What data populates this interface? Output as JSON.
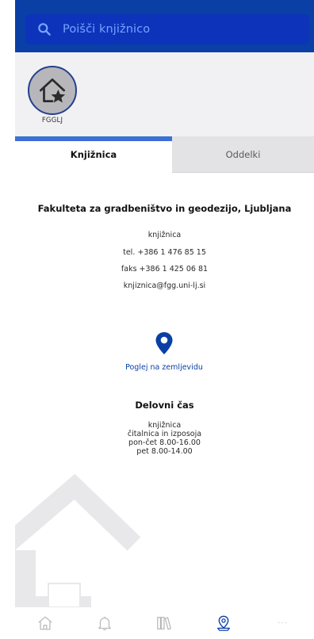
{
  "search": {
    "placeholder": "Poišči knjižnico"
  },
  "library": {
    "code": "FGGLJ"
  },
  "tabs": [
    {
      "label": "Knjižnica",
      "active": true
    },
    {
      "label": "Oddelki",
      "active": false
    }
  ],
  "details": {
    "name": "Fakulteta za gradbeništvo in geodezijo, Ljubljana",
    "department": "knjižnica",
    "phone": "tel. +386 1 476 85 15",
    "fax": "faks +386 1 425 06 81",
    "email": "knjiznica@fgg.uni-lj.si"
  },
  "map": {
    "label": "Poglej na zemljevidu"
  },
  "hours": {
    "title": "Delovni čas",
    "lines": [
      "knjižnica",
      "čitalnica in izposoja",
      "pon-čet 8.00-16.00",
      "pet 8.00-14.00"
    ]
  },
  "bottom_nav": {
    "items": [
      {
        "icon": "home-icon",
        "active": false
      },
      {
        "icon": "bell-icon",
        "active": false
      },
      {
        "icon": "books-icon",
        "active": false
      },
      {
        "icon": "map-pin-icon",
        "active": true
      },
      {
        "icon": "more-icon",
        "active": false,
        "label": "···"
      }
    ]
  },
  "colors": {
    "header": "#0a3fa6",
    "search_bg": "#0d33bb",
    "accent": "#3c70d4",
    "link": "#0a3fa6"
  }
}
